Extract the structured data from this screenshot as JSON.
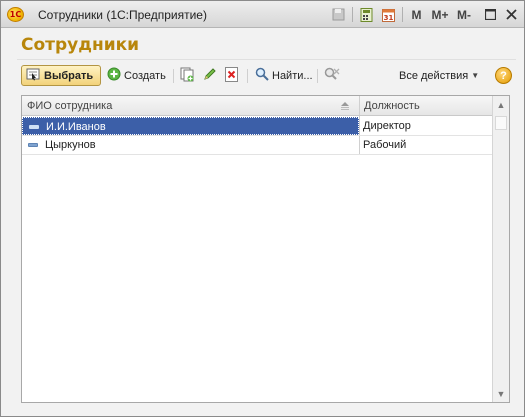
{
  "window": {
    "title": "Сотрудники  (1С:Предприятие)",
    "logo_text": "1С",
    "controls": {
      "memory_m": "M",
      "memory_plus": "M+",
      "memory_minus": "M-"
    }
  },
  "form": {
    "title": "Сотрудники"
  },
  "toolbar": {
    "select_label": "Выбрать",
    "create_label": "Создать",
    "find_label": "Найти...",
    "all_actions_label": "Все действия",
    "help_label": "?"
  },
  "table": {
    "columns": [
      "ФИО сотрудника",
      "Должность"
    ],
    "rows": [
      {
        "name": "И.И.Иванов",
        "position": "Директор",
        "selected": true
      },
      {
        "name": "Цыркунов",
        "position": "Рабочий",
        "selected": false
      }
    ]
  },
  "colors": {
    "accent": "#b8860b",
    "selection": "#3c5fa8"
  }
}
